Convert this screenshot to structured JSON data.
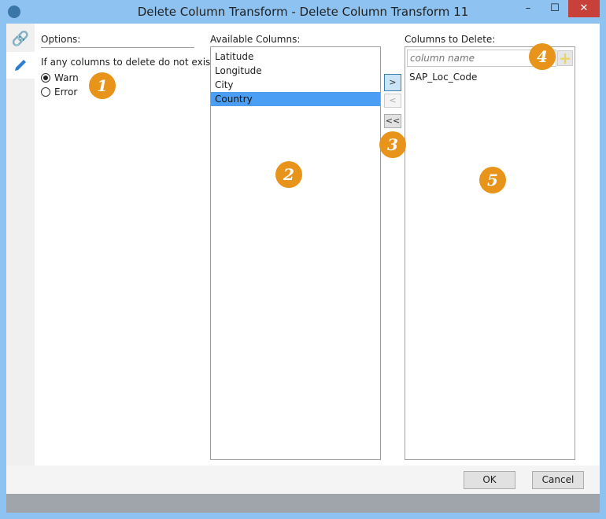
{
  "window": {
    "title": "Delete Column Transform - Delete Column Transform 11",
    "minimize": "–",
    "maximize": "☐",
    "close": "✕"
  },
  "options": {
    "header": "Options:",
    "question": "If any columns to delete do not exist:",
    "radios": [
      {
        "label": "Warn",
        "checked": true
      },
      {
        "label": "Error",
        "checked": false
      }
    ]
  },
  "available": {
    "label": "Available Columns:",
    "items": [
      "Latitude",
      "Longitude",
      "City",
      "Country"
    ],
    "selected": "Country"
  },
  "transfer": {
    "add": ">",
    "remove": "<",
    "remove_all": "<<"
  },
  "delete": {
    "label": "Columns to Delete:",
    "placeholder": "column name",
    "items": [
      "SAP_Loc_Code"
    ]
  },
  "badges": [
    "1",
    "2",
    "3",
    "4",
    "5"
  ],
  "footer": {
    "ok": "OK",
    "cancel": "Cancel"
  },
  "colors": {
    "accent": "#4a9ff5",
    "badge": "#e8931a",
    "titlebar": "#8ec2f0",
    "close": "#c7403a"
  }
}
